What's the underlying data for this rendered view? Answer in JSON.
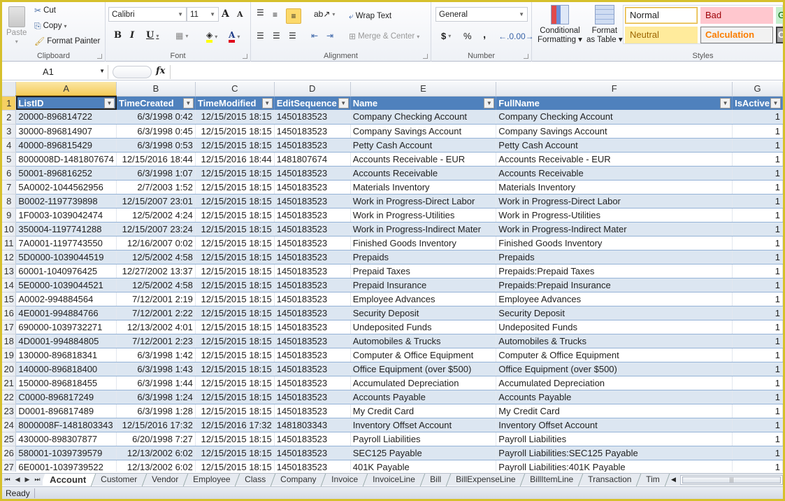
{
  "ribbon": {
    "clipboard": {
      "label": "Clipboard",
      "paste": "Paste",
      "cut": "Cut",
      "copy": "Copy",
      "format_painter": "Format Painter"
    },
    "font": {
      "label": "Font",
      "family": "Calibri",
      "size": "11",
      "bold": "B",
      "italic": "I",
      "underline": "U",
      "grow": "A",
      "shrink": "A",
      "font_color_hex": "#e0001a",
      "fill_color_hex": "#ffff00"
    },
    "alignment": {
      "label": "Alignment",
      "wrap_text": "Wrap Text",
      "merge_center": "Merge & Center"
    },
    "number": {
      "label": "Number",
      "format": "General",
      "currency": "$",
      "percent": "%",
      "comma": ",",
      "inc_decimal": ".0→.00",
      "dec_decimal": ".00→.0"
    },
    "styles": {
      "label": "Styles",
      "conditional_formatting": [
        "Conditional",
        "Formatting"
      ],
      "format_as_table": [
        "Format",
        "as Table"
      ],
      "cells": [
        {
          "label": "Normal"
        },
        {
          "label": "Bad"
        },
        {
          "label": "G"
        },
        {
          "label": "Neutral"
        },
        {
          "label": "Calculation"
        },
        {
          "label": "C"
        }
      ]
    }
  },
  "formula_bar": {
    "name_box": "A1",
    "fx": "fx",
    "formula": ""
  },
  "columns": [
    "A",
    "B",
    "C",
    "D",
    "E",
    "F",
    "G"
  ],
  "headers": [
    "ListID",
    "TimeCreated",
    "TimeModified",
    "EditSequence",
    "Name",
    "FullName",
    "IsActive"
  ],
  "rows": [
    {
      "n": "2",
      "cells": [
        "20000-896814722",
        "6/3/1998 0:42",
        "12/15/2015 18:15",
        "1450183523",
        "Company Checking Account",
        "Company Checking Account",
        "1"
      ]
    },
    {
      "n": "3",
      "cells": [
        "30000-896814907",
        "6/3/1998 0:45",
        "12/15/2015 18:15",
        "1450183523",
        "Company Savings Account",
        "Company Savings Account",
        "1"
      ]
    },
    {
      "n": "4",
      "cells": [
        "40000-896815429",
        "6/3/1998 0:53",
        "12/15/2015 18:15",
        "1450183523",
        "Petty Cash Account",
        "Petty Cash Account",
        "1"
      ]
    },
    {
      "n": "5",
      "cells": [
        "8000008D-1481807674",
        "12/15/2016 18:44",
        "12/15/2016 18:44",
        "1481807674",
        "Accounts Receivable - EUR",
        "Accounts Receivable - EUR",
        "1"
      ]
    },
    {
      "n": "6",
      "cells": [
        "50001-896816252",
        "6/3/1998 1:07",
        "12/15/2015 18:15",
        "1450183523",
        "Accounts Receivable",
        "Accounts Receivable",
        "1"
      ]
    },
    {
      "n": "7",
      "cells": [
        "5A0002-1044562956",
        "2/7/2003 1:52",
        "12/15/2015 18:15",
        "1450183523",
        "Materials Inventory",
        "Materials Inventory",
        "1"
      ]
    },
    {
      "n": "8",
      "cells": [
        "B0002-1197739898",
        "12/15/2007 23:01",
        "12/15/2015 18:15",
        "1450183523",
        "Work in Progress-Direct Labor",
        "Work in Progress-Direct Labor",
        "1"
      ]
    },
    {
      "n": "9",
      "cells": [
        "1F0003-1039042474",
        "12/5/2002 4:24",
        "12/15/2015 18:15",
        "1450183523",
        "Work in Progress-Utilities",
        "Work in Progress-Utilities",
        "1"
      ]
    },
    {
      "n": "10",
      "cells": [
        "350004-1197741288",
        "12/15/2007 23:24",
        "12/15/2015 18:15",
        "1450183523",
        "Work in Progress-Indirect Mater",
        "Work in Progress-Indirect Mater",
        "1"
      ]
    },
    {
      "n": "11",
      "cells": [
        "7A0001-1197743550",
        "12/16/2007 0:02",
        "12/15/2015 18:15",
        "1450183523",
        "Finished Goods Inventory",
        "Finished Goods Inventory",
        "1"
      ]
    },
    {
      "n": "12",
      "cells": [
        "5D0000-1039044519",
        "12/5/2002 4:58",
        "12/15/2015 18:15",
        "1450183523",
        "Prepaids",
        "Prepaids",
        "1"
      ]
    },
    {
      "n": "13",
      "cells": [
        "60001-1040976425",
        "12/27/2002 13:37",
        "12/15/2015 18:15",
        "1450183523",
        "Prepaid Taxes",
        "Prepaids:Prepaid Taxes",
        "1"
      ]
    },
    {
      "n": "14",
      "cells": [
        "5E0000-1039044521",
        "12/5/2002 4:58",
        "12/15/2015 18:15",
        "1450183523",
        "Prepaid Insurance",
        "Prepaids:Prepaid Insurance",
        "1"
      ]
    },
    {
      "n": "15",
      "cells": [
        "A0002-994884564",
        "7/12/2001 2:19",
        "12/15/2015 18:15",
        "1450183523",
        "Employee Advances",
        "Employee Advances",
        "1"
      ]
    },
    {
      "n": "16",
      "cells": [
        "4E0001-994884766",
        "7/12/2001 2:22",
        "12/15/2015 18:15",
        "1450183523",
        "Security Deposit",
        "Security Deposit",
        "1"
      ]
    },
    {
      "n": "17",
      "cells": [
        "690000-1039732271",
        "12/13/2002 4:01",
        "12/15/2015 18:15",
        "1450183523",
        "Undeposited Funds",
        "Undeposited Funds",
        "1"
      ]
    },
    {
      "n": "18",
      "cells": [
        "4D0001-994884805",
        "7/12/2001 2:23",
        "12/15/2015 18:15",
        "1450183523",
        "Automobiles & Trucks",
        "Automobiles & Trucks",
        "1"
      ]
    },
    {
      "n": "19",
      "cells": [
        "130000-896818341",
        "6/3/1998 1:42",
        "12/15/2015 18:15",
        "1450183523",
        "Computer & Office Equipment",
        "Computer & Office Equipment",
        "1"
      ]
    },
    {
      "n": "20",
      "cells": [
        "140000-896818400",
        "6/3/1998 1:43",
        "12/15/2015 18:15",
        "1450183523",
        "Office Equipment  (over $500)",
        "Office Equipment  (over $500)",
        "1"
      ]
    },
    {
      "n": "21",
      "cells": [
        "150000-896818455",
        "6/3/1998 1:44",
        "12/15/2015 18:15",
        "1450183523",
        "Accumulated Depreciation",
        "Accumulated Depreciation",
        "1"
      ]
    },
    {
      "n": "22",
      "cells": [
        "C0000-896817249",
        "6/3/1998 1:24",
        "12/15/2015 18:15",
        "1450183523",
        "Accounts Payable",
        "Accounts Payable",
        "1"
      ]
    },
    {
      "n": "23",
      "cells": [
        "D0001-896817489",
        "6/3/1998 1:28",
        "12/15/2015 18:15",
        "1450183523",
        "My Credit Card",
        "My Credit Card",
        "1"
      ]
    },
    {
      "n": "24",
      "cells": [
        "8000008F-1481803343",
        "12/15/2016 17:32",
        "12/15/2016 17:32",
        "1481803343",
        "Inventory Offset Account",
        "Inventory Offset Account",
        "1"
      ]
    },
    {
      "n": "25",
      "cells": [
        "430000-898307877",
        "6/20/1998 7:27",
        "12/15/2015 18:15",
        "1450183523",
        "Payroll Liabilities",
        "Payroll Liabilities",
        "1"
      ]
    },
    {
      "n": "26",
      "cells": [
        "580001-1039739579",
        "12/13/2002 6:02",
        "12/15/2015 18:15",
        "1450183523",
        "SEC125 Payable",
        "Payroll Liabilities:SEC125 Payable",
        "1"
      ]
    },
    {
      "n": "27",
      "cells": [
        "6E0001-1039739522",
        "12/13/2002 6:02",
        "12/15/2015 18:15",
        "1450183523",
        "401K Payable",
        "Payroll Liabilities:401K Payable",
        "1"
      ]
    }
  ],
  "sheet_tabs": [
    "Account",
    "Customer",
    "Vendor",
    "Employee",
    "Class",
    "Company",
    "Invoice",
    "InvoiceLine",
    "Bill",
    "BillExpenseLine",
    "BillItemLine",
    "Transaction",
    "Tim"
  ],
  "active_tab": "Account",
  "status": {
    "text": "Ready"
  },
  "colors": {
    "header_blue": "#4f81bd",
    "band_blue": "#dce6f1",
    "selected_col": "#f5cf62"
  }
}
